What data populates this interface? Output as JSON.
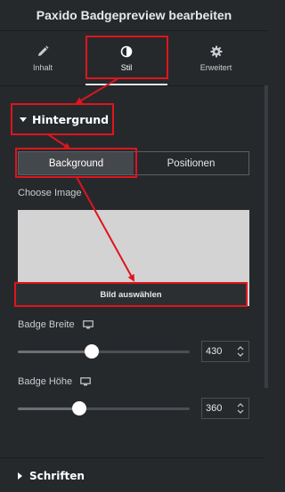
{
  "header": {
    "title": "Paxido Badgepreview bearbeiten"
  },
  "tabs": [
    {
      "label": "Inhalt",
      "icon": "pencil-icon"
    },
    {
      "label": "Stil",
      "icon": "half-circle-icon",
      "active": true
    },
    {
      "label": "Erweitert",
      "icon": "gear-icon"
    }
  ],
  "section": {
    "title": "Hintergrund",
    "switch": {
      "options": [
        "Background",
        "Positionen"
      ],
      "active": "Background"
    },
    "image_label": "Choose Image",
    "select_button": "Bild auswählen",
    "badge_width": {
      "label": "Badge Breite",
      "value": "430",
      "slider_fraction": 0.43
    },
    "badge_height": {
      "label": "Badge Höhe",
      "value": "360",
      "slider_fraction": 0.36
    }
  },
  "footer_section": {
    "title": "Schriften"
  },
  "colors": {
    "background": "#26292c",
    "annotation": "#e0141d",
    "image_placeholder": "#d3d3d3"
  }
}
